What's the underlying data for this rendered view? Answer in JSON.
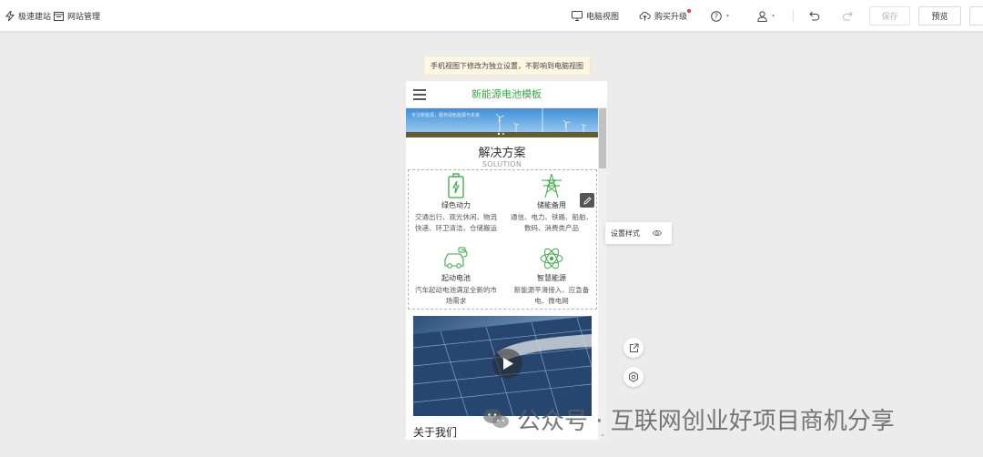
{
  "toolbar": {
    "quick_build": "极速建站",
    "site_manage": "网站管理",
    "desktop_view": "电脑视图",
    "upgrade": "购买升级",
    "save": "保存",
    "preview": "预览"
  },
  "notice": "手机视图下修改为独立设置，不影响到电脑视图",
  "phone": {
    "title": "新能源电池模板",
    "banner_text": "专注新能源，服务绿色能源与未来",
    "section_title": "解决方案",
    "section_subtitle": "SOLUTION",
    "cards": [
      {
        "name": "绿色动力",
        "desc": "交通出行、观光休闲、物流快递、环卫清洁、仓储搬运"
      },
      {
        "name": "储能备用",
        "desc": "通信、电力、铁路、船舶、数码、消费类产品"
      },
      {
        "name": "起动电池",
        "desc": "汽车起动电池满足全新的市场需求"
      },
      {
        "name": "智慧能源",
        "desc": "新能源平滑接入、应急备电、微电网"
      }
    ],
    "about_title": "关于我们"
  },
  "style_popup": {
    "label": "设置样式"
  },
  "watermark": "公众号 · 互联网创业好项目商机分享",
  "colors": {
    "accent_green": "#3aa845",
    "notice_bg": "#fdf6e3",
    "canvas_bg": "#ececec"
  }
}
